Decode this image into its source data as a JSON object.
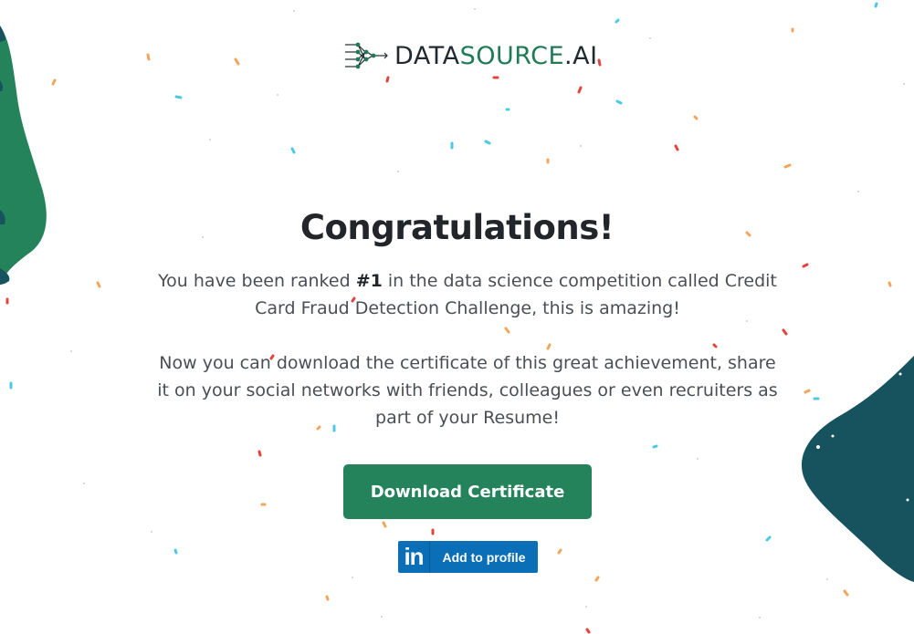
{
  "colors": {
    "brand_green": "#24835a",
    "brand_teal": "#17535f",
    "linkedin_blue": "#0a6fb6",
    "title_text": "#22262a",
    "body_text": "#4a4f54"
  },
  "logo": {
    "word_data": "DATA",
    "word_source": "SOURCE",
    "word_ai": ".AI",
    "icon": "neural-network-icon"
  },
  "main": {
    "title": "Congratulations!",
    "para1_before": "You have been ranked ",
    "para1_rank": "#1",
    "para1_after": " in the data science competition called Credit Card Fraud Detection Challenge, this is amazing!",
    "para2": "Now you can download the certificate of this great achievement, share it on your social networks with friends, colleagues or even recruiters as part of your Resume!",
    "download_button": "Download Certificate"
  },
  "linkedin": {
    "logo_text": "in",
    "label": "Add to profile",
    "icon": "linkedin-icon"
  },
  "decoration": {
    "confetti": "confetti-pattern",
    "left_blob": "green-blob",
    "right_blob": "teal-blob"
  }
}
